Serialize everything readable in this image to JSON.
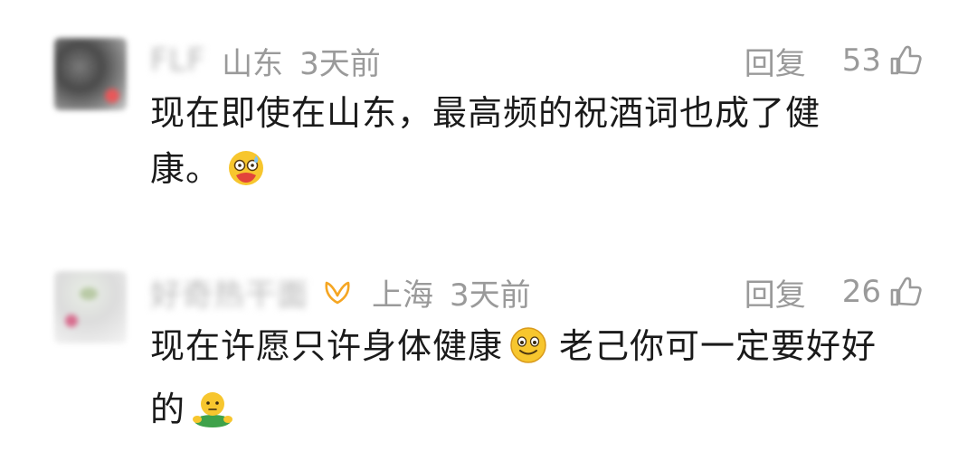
{
  "comments": [
    {
      "username": "FLF",
      "location": "山东",
      "time": "3天前",
      "reply_label": "回复",
      "likes": "53",
      "line1": "现在即使在山东，最高频的祝酒词也成了健",
      "line2": "康。",
      "emoji": "sweating-face-emoji"
    },
    {
      "username": "好奇热干面",
      "location": "上海",
      "time": "3天前",
      "reply_label": "回复",
      "likes": "26",
      "line1a": "现在许愿只许身体健康",
      "line1b": "老己你可一定要好好",
      "line2": "的",
      "emoji1": "smiling-face-emoji",
      "emoji2": "hugging-person-emoji",
      "badge": "vip-badge-icon"
    }
  ],
  "colors": {
    "meta_gray": "#9a9a9a",
    "text_dark": "#1a1a1a",
    "vip_orange": "#f5a623",
    "emoji_yellow": "#f7c62e"
  }
}
